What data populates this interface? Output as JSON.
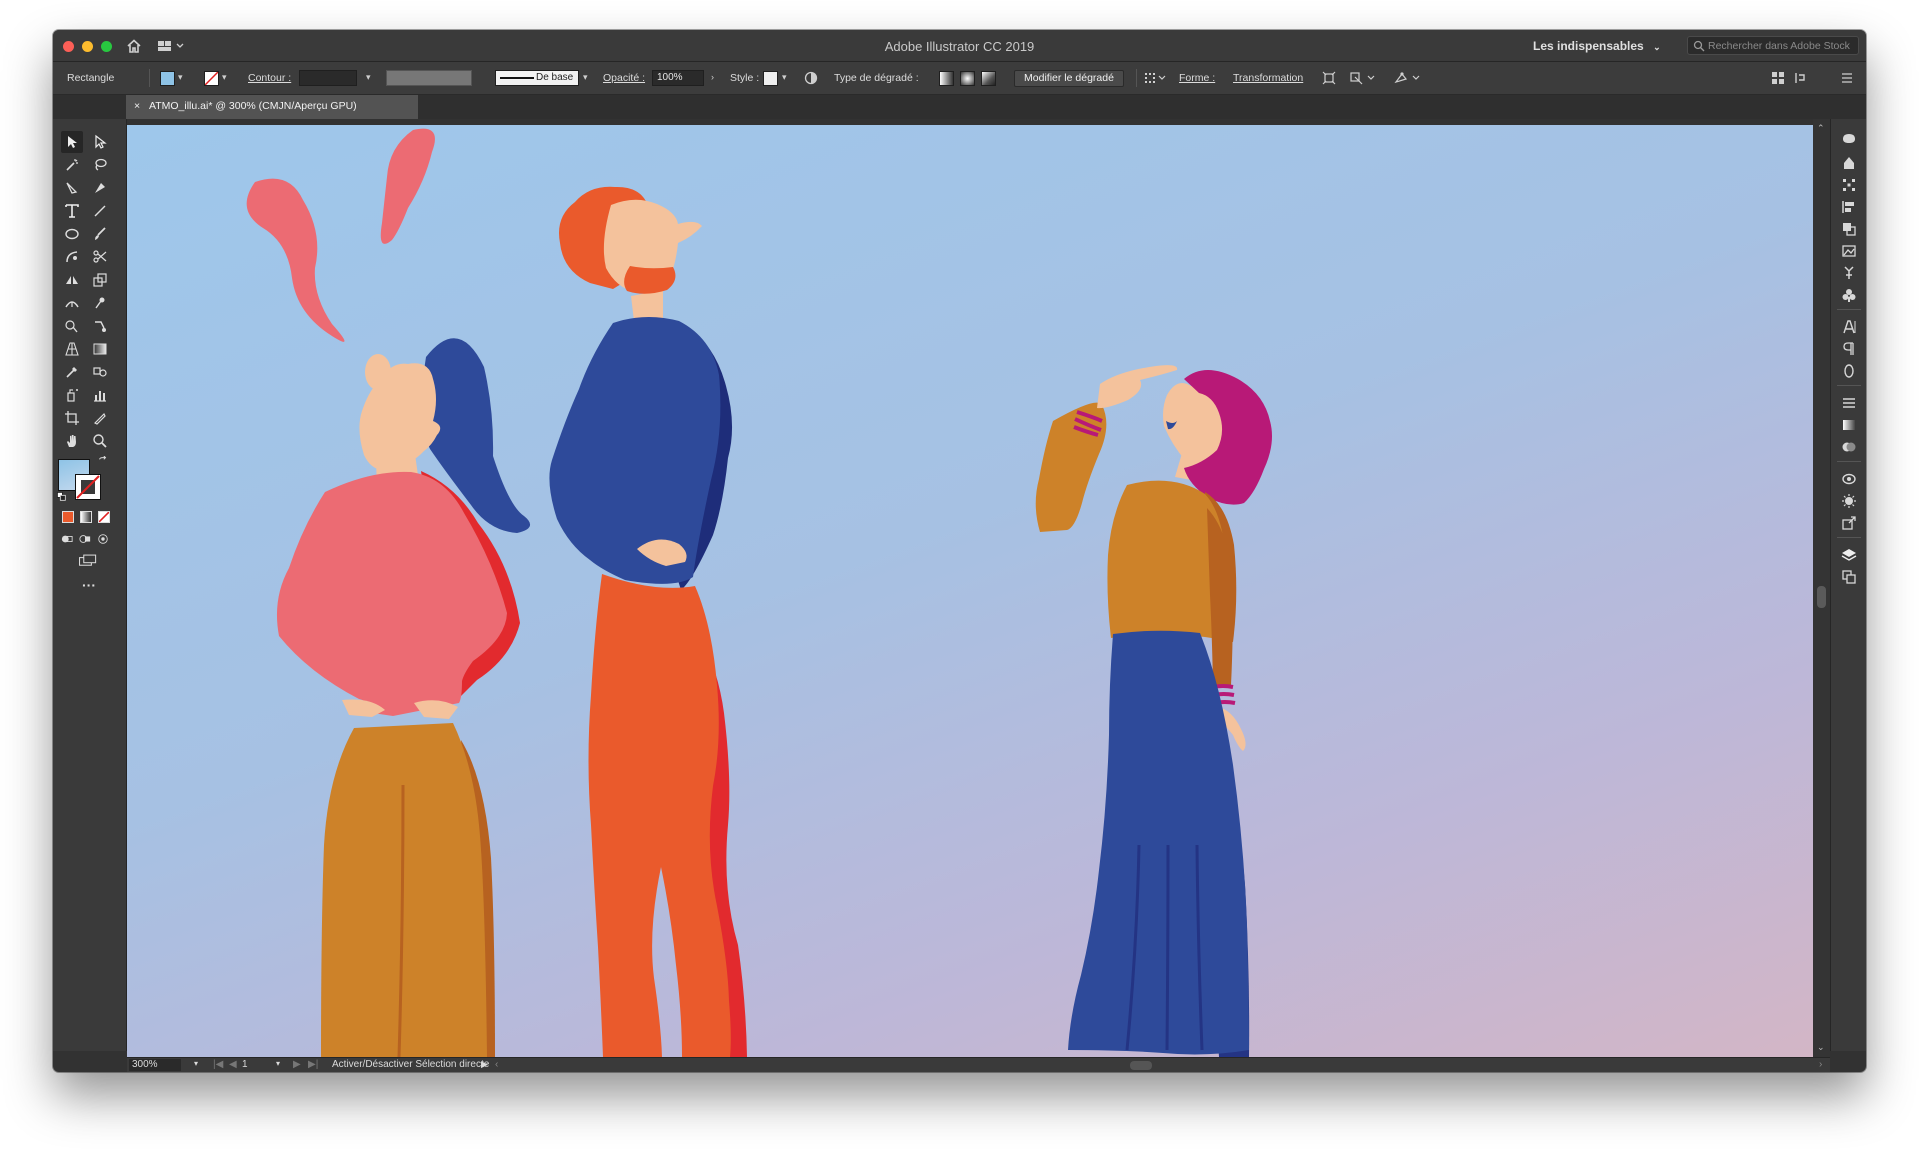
{
  "window": {
    "title": "Adobe Illustrator CC 2019",
    "workspace": "Les indispensables",
    "stock_search_placeholder": "Rechercher dans Adobe Stock"
  },
  "control_bar": {
    "selection_type": "Rectangle",
    "stroke_label": "Contour :",
    "stroke_profile": "De base",
    "opacity_label": "Opacité :",
    "opacity_value": "100%",
    "style_label": "Style :",
    "gradient_type_label": "Type de dégradé :",
    "edit_gradient_button": "Modifier le dégradé",
    "shape_label": "Forme :",
    "transform_label": "Transformation",
    "fill_color": "#8ec3e6"
  },
  "document_tab": {
    "close_glyph": "×",
    "title": "ATMO_illu.ai* @ 300% (CMJN/Aperçu GPU)"
  },
  "status_bar": {
    "zoom": "300%",
    "artboard": "1",
    "status_text": "Activer/Désactiver Sélection directe"
  },
  "toolbar": {
    "more_glyph": "···"
  },
  "artwork": {
    "background_from": "#9ec7eb",
    "background_to": "#d3b6c6",
    "palette": {
      "pink": "#ec6b73",
      "skin": "#f4c29c",
      "navy": "#2e4a9a",
      "ochre": "#cd8229",
      "orange": "#ea5a2c",
      "red": "#e22a2e",
      "magenta": "#b81977"
    }
  }
}
